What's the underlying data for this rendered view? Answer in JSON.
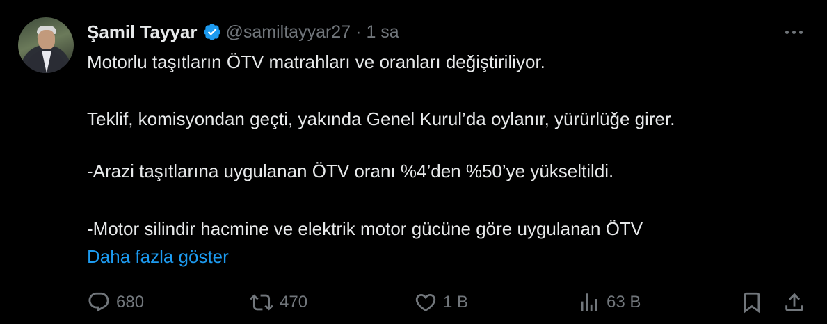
{
  "tweet": {
    "author_name": "Şamil Tayyar",
    "handle": "@samiltayyar27",
    "separator": "·",
    "time": "1 sa",
    "lines": [
      "Motorlu taşıtların ÖTV matrahları ve oranları değiştiriliyor.",
      "Teklif, komisyondan geçti, yakında Genel Kurul’da oylanır, yürürlüğe girer.",
      "-Arazi taşıtlarına uygulanan ÖTV oranı %4’den %50’ye yükseltildi.",
      "-Motor silindir hacmine ve elektrik motor gücüne göre uygulanan ÖTV"
    ],
    "show_more": "Daha fazla göster"
  },
  "actions": {
    "replies": "680",
    "retweets": "470",
    "likes": "1 B",
    "views": "63 B"
  },
  "icons": [
    "verified-badge-icon",
    "more-options-icon",
    "reply-icon",
    "retweet-icon",
    "like-icon",
    "views-icon",
    "bookmark-icon",
    "share-icon"
  ],
  "colors": {
    "background": "#000000",
    "text": "#e7e9ea",
    "muted": "#71767b",
    "link": "#1d9bf0"
  }
}
